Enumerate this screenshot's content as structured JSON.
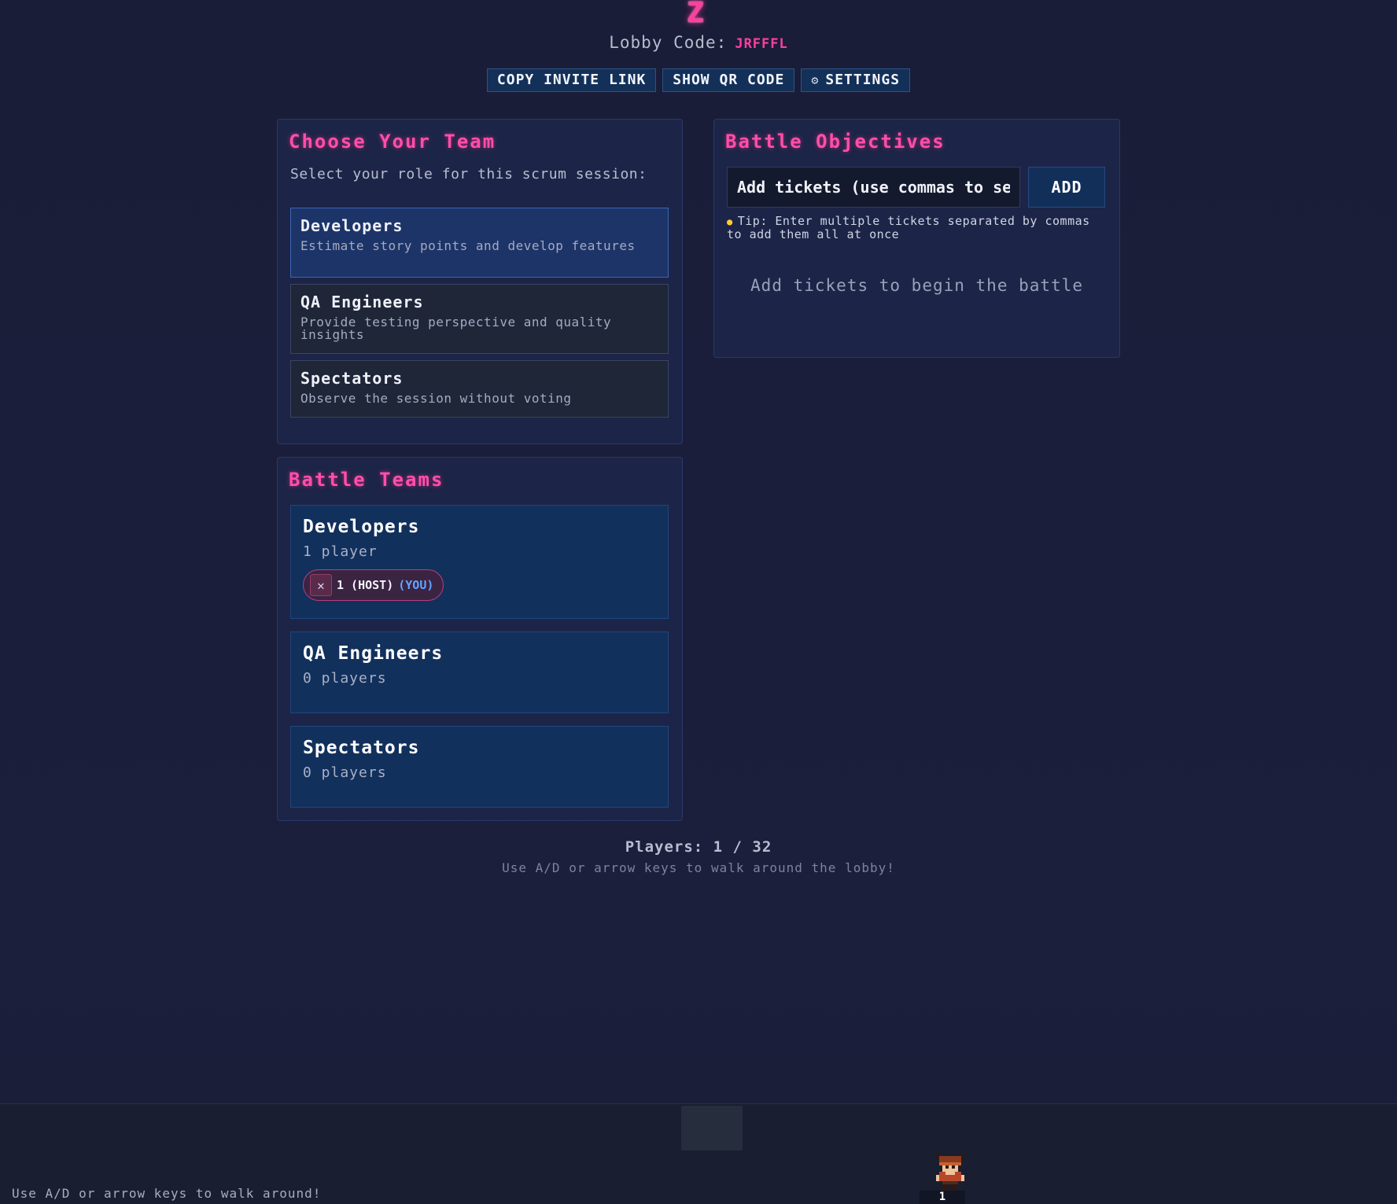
{
  "header": {
    "logo_glyph": "Z",
    "lobby_code_label": "Lobby Code:",
    "lobby_code": "JRFFFL",
    "actions": {
      "copy_invite": "COPY INVITE LINK",
      "show_qr": "SHOW QR CODE",
      "settings": "SETTINGS",
      "settings_icon": "gear-icon"
    }
  },
  "choose_team": {
    "title": "Choose Your Team",
    "subtitle": "Select your role for this scrum session:",
    "roles": [
      {
        "name": "Developers",
        "description": "Estimate story points and develop features",
        "selected": true
      },
      {
        "name": "QA Engineers",
        "description": "Provide testing perspective and quality insights",
        "selected": false
      },
      {
        "name": "Spectators",
        "description": "Observe the session without voting",
        "selected": false
      }
    ]
  },
  "battle_teams": {
    "title": "Battle Teams",
    "teams": [
      {
        "name": "Developers",
        "count_label": "1 player",
        "players": [
          {
            "icon": "crossed-swords-icon",
            "label": "1 (HOST)",
            "you_label": "(YOU)"
          }
        ]
      },
      {
        "name": "QA Engineers",
        "count_label": "0 players",
        "players": []
      },
      {
        "name": "Spectators",
        "count_label": "0 players",
        "players": []
      }
    ]
  },
  "battle_objectives": {
    "title": "Battle Objectives",
    "ticket_input_placeholder": "Add tickets (use commas to separate multiple)",
    "add_button": "ADD",
    "tip_icon": "lightbulb-icon",
    "tip": "Tip: Enter multiple tickets separated by commas to add them all at once",
    "empty_state": "Add tickets to begin the battle"
  },
  "status": {
    "players_count": "Players: 1 / 32",
    "walk_hint": "Use A/D or arrow keys to walk around the lobby!"
  },
  "walk_area": {
    "hint": "Use A/D or arrow keys to walk around!",
    "avatar_label": "1"
  },
  "colors": {
    "accent_pink": "#ff4fa8",
    "background": "#1a1d38",
    "panel": "#1c2547",
    "team_card": "#12305c",
    "you_blue": "#5fa6ff"
  }
}
